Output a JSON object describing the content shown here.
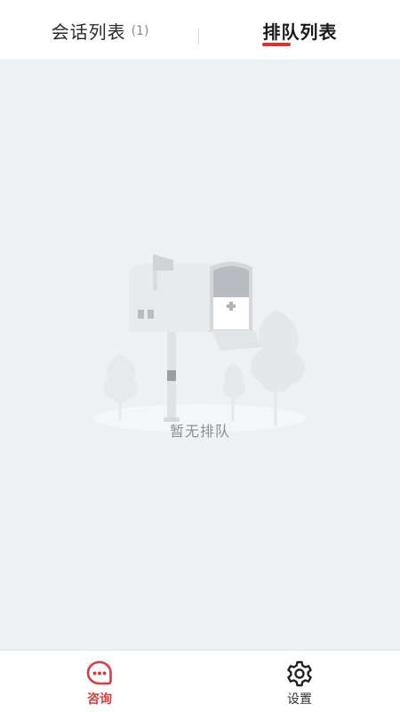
{
  "tabs": [
    {
      "label": "会话列表",
      "count": "(1)",
      "active": false
    },
    {
      "label": "排队列表",
      "active": true
    }
  ],
  "empty_state": {
    "message": "暂无排队"
  },
  "bottom_nav": [
    {
      "label": "咨询",
      "icon": "chat-bubble-icon",
      "active": true
    },
    {
      "label": "设置",
      "icon": "gear-icon",
      "active": false
    }
  ],
  "colors": {
    "accent": "#e0302f",
    "nav_active": "#d93a3a",
    "background": "#eef1f3"
  }
}
